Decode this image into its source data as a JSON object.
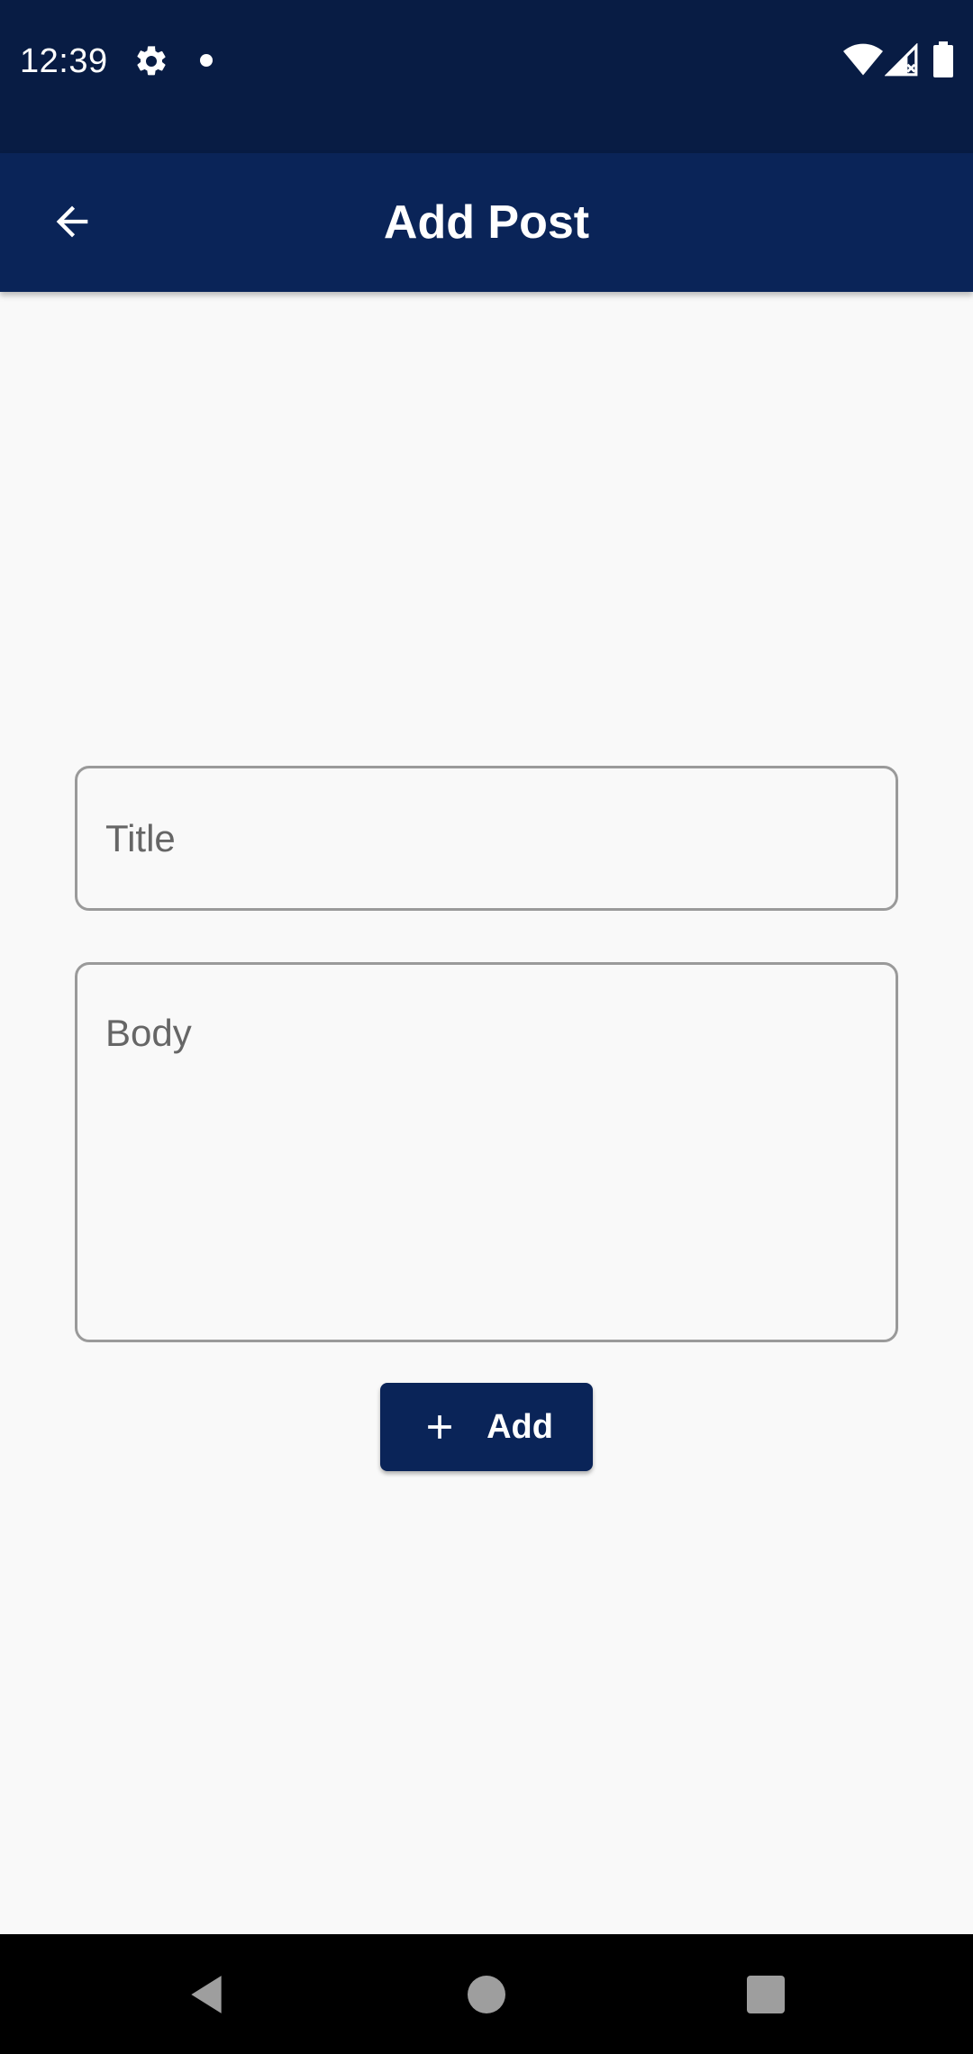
{
  "status_bar": {
    "time": "12:39",
    "icons": [
      "gear-icon",
      "dot-icon",
      "wifi-icon",
      "signal-icon",
      "battery-icon"
    ]
  },
  "app_bar": {
    "title": "Add Post",
    "back_icon": "arrow-left-icon"
  },
  "form": {
    "title_placeholder": "Title",
    "body_placeholder": "Body",
    "add_label": "Add",
    "add_icon": "plus-icon"
  },
  "nav_bar": {
    "icons": [
      "nav-back-icon",
      "nav-home-icon",
      "nav-recents-icon"
    ]
  },
  "colors": {
    "status_bar": "#081c44",
    "app_bar": "#0a2458",
    "background": "#f9f9f9",
    "field_border": "#9a9a9a",
    "placeholder": "#666666",
    "button": "#0a2458"
  }
}
